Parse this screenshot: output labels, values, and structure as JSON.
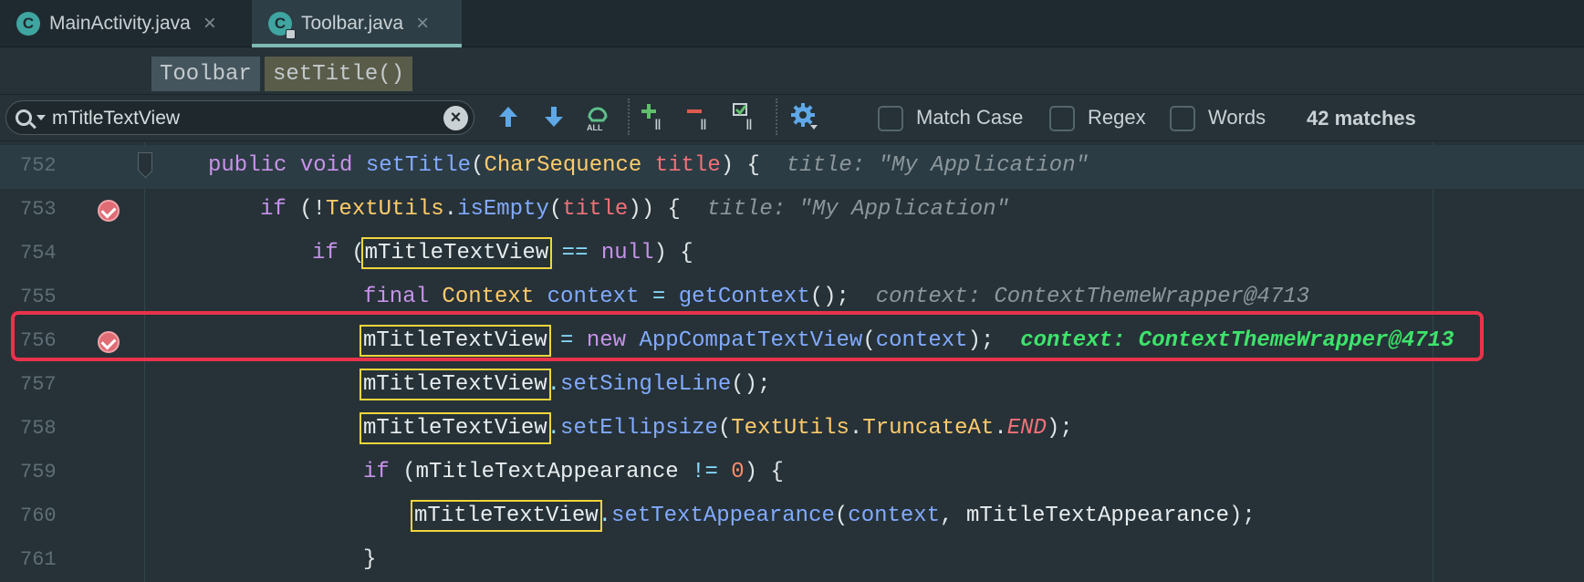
{
  "tabs": [
    {
      "icon": "C",
      "label": "MainActivity.java",
      "close": "×"
    },
    {
      "icon": "C",
      "label": "Toolbar.java",
      "close": "×"
    }
  ],
  "breadcrumb": [
    "Toolbar",
    "setTitle()"
  ],
  "search": {
    "query": "mTitleTextView",
    "clear_icon": "×",
    "options": [
      "Match Case",
      "Regex",
      "Words"
    ],
    "matches": "42 matches"
  },
  "colors": {
    "background": "#263238",
    "keyword": "#c792ea",
    "function": "#82aaff",
    "type": "#ffcb6b",
    "parameter": "#f07178",
    "match_outline": "#f0d53c",
    "breakpoint": "#e06c75",
    "highlight_box": "#e8334a",
    "inline_hint_highlight": "#3ee36a"
  },
  "lines": [
    {
      "num": "752",
      "code": [
        "public",
        "void",
        "setTitle",
        "CharSequence",
        "title",
        "{",
        "title: \"My Application\""
      ]
    },
    {
      "num": "753",
      "code": [
        "if",
        "(!",
        "TextUtils",
        ".",
        "isEmpty",
        "title",
        ")) {",
        "title: \"My Application\""
      ]
    },
    {
      "num": "754",
      "code": [
        "if",
        "(",
        "mTitleTextView",
        "==",
        "null",
        ") {"
      ]
    },
    {
      "num": "755",
      "code": [
        "final",
        "Context",
        "context",
        "=",
        "getContext",
        "();",
        "context: ContextThemeWrapper@4713"
      ]
    },
    {
      "num": "756",
      "code": [
        "mTitleTextView",
        "=",
        "new",
        "AppCompatTextView",
        "context",
        ");",
        "context: ContextThemeWrapper@4713"
      ]
    },
    {
      "num": "757",
      "code": [
        "mTitleTextView",
        ".",
        "setSingleLine",
        "();"
      ]
    },
    {
      "num": "758",
      "code": [
        "mTitleTextView",
        ".",
        "setEllipsize",
        "TextUtils",
        "TruncateAt",
        "END",
        ");"
      ]
    },
    {
      "num": "759",
      "code": [
        "if",
        "mTitleTextAppearance",
        "!=",
        "0",
        ") {"
      ]
    },
    {
      "num": "760",
      "code": [
        "mTitleTextView",
        ".",
        "setTextAppearance",
        "context",
        "mTitleTextAppearance",
        ");"
      ]
    },
    {
      "num": "761",
      "code": [
        "}"
      ]
    }
  ]
}
